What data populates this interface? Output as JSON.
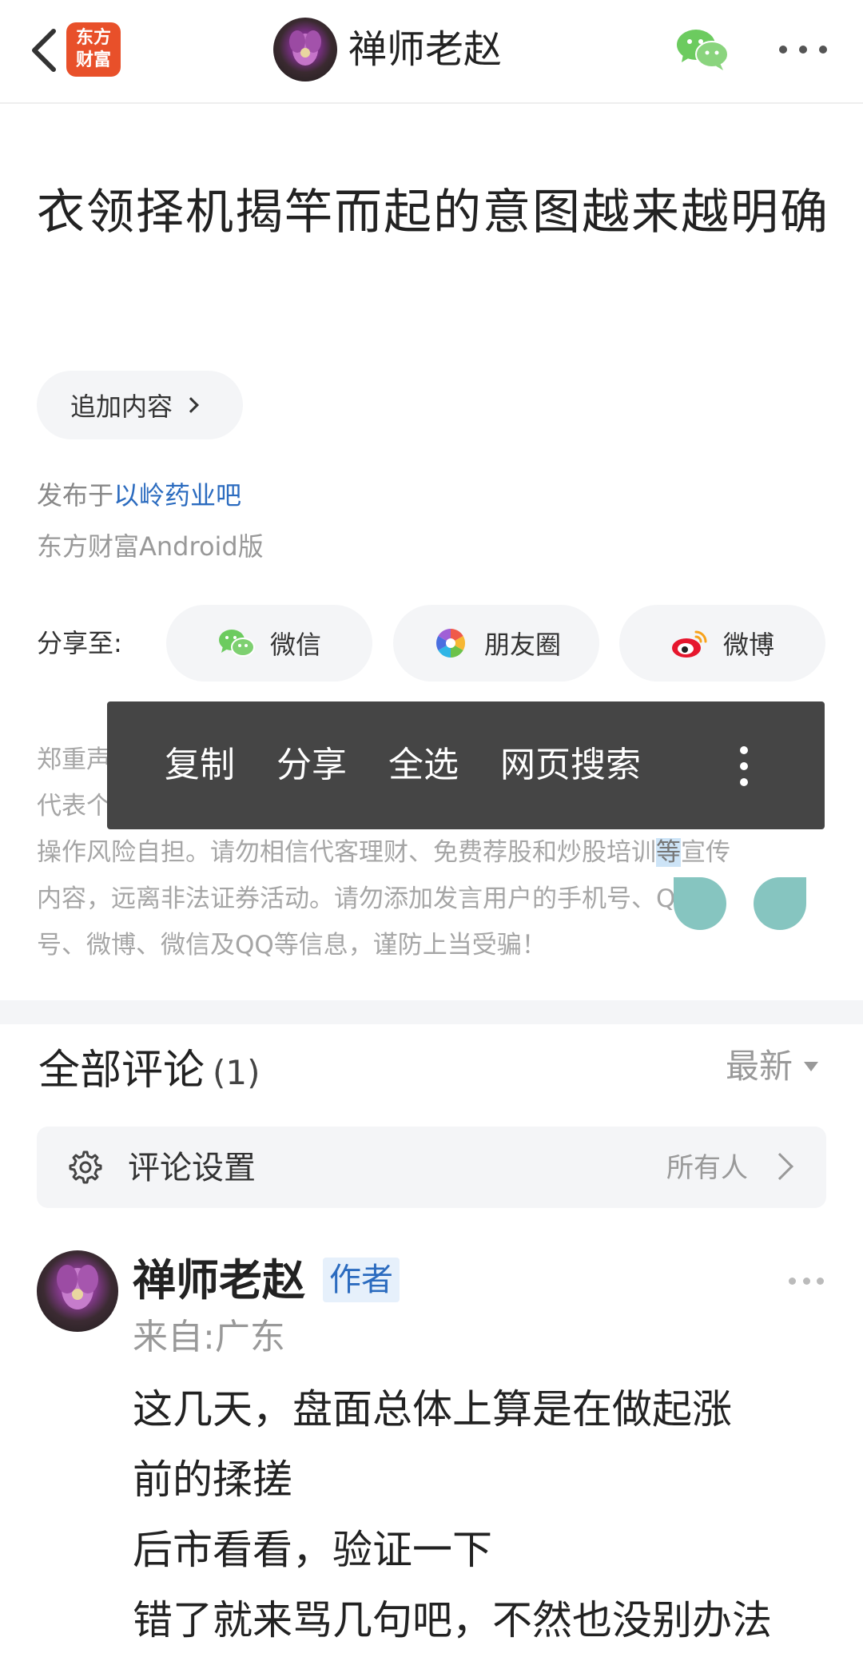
{
  "topbar": {
    "app_logo_line1": "东方",
    "app_logo_line2": "财富",
    "author": "禅师老赵"
  },
  "article": {
    "title": "衣领择机揭竿而起的意图越来越明确",
    "append_label": "追加内容",
    "posted_prefix": "发布于",
    "forum": "以岭药业吧",
    "client": "东方财富Android版"
  },
  "share": {
    "label": "分享至:",
    "options": [
      "微信",
      "朋友圈",
      "微博"
    ]
  },
  "disclaimer": {
    "line1_start": "郑重声",
    "line2_start": "代表个",
    "line3_before": "操作风险自担。请勿相信代客理财、免费荐股和炒股培训",
    "line3_selected": "等",
    "line3_after": "宣传",
    "line4": "内容，远离非法证券活动。请勿添加发言用户的手机号、QQ",
    "line5": "号、微博、微信及QQ等信息，谨防上当受骗！"
  },
  "context_menu": {
    "items": [
      "复制",
      "分享",
      "全选",
      "网页搜索"
    ]
  },
  "comments": {
    "title": "全部评论",
    "count": "(1)",
    "sort": "最新",
    "settings_label": "评论设置",
    "settings_value": "所有人"
  },
  "comment": {
    "author": "禅师老赵",
    "badge": "作者",
    "location": "来自:广东",
    "lines": [
      "这几天，盘面总体上算是在做起涨",
      "前的揉搓",
      "后市看看，验证一下",
      "错了就来骂几句吧，不然也没别办法"
    ]
  },
  "colors": {
    "link": "#2b6bbf",
    "menu_bg": "#454545",
    "selection_handle": "#86c5c0",
    "logo_bg": "#e8502a"
  },
  "icons": [
    "back-arrow-icon",
    "wechat-icon",
    "more-icon",
    "moments-icon",
    "weibo-icon",
    "gear-icon",
    "chevron-right-icon"
  ]
}
